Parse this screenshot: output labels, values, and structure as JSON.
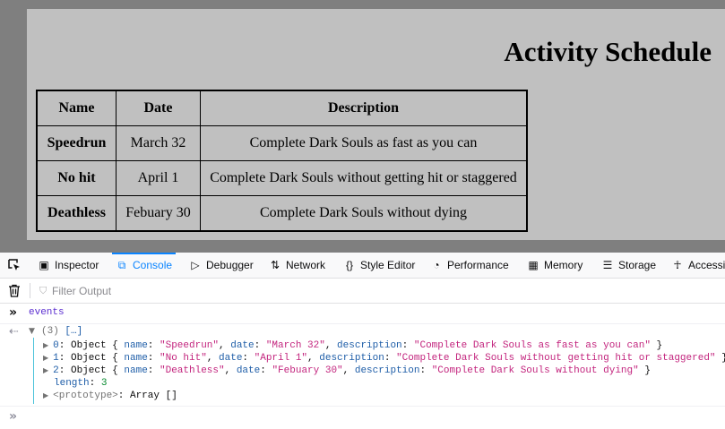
{
  "page": {
    "title": "Activity Schedule",
    "table": {
      "headers": [
        "Name",
        "Date",
        "Description"
      ],
      "rows": [
        {
          "name": "Speedrun",
          "date": "March 32",
          "description": "Complete Dark Souls as fast as you can"
        },
        {
          "name": "No hit",
          "date": "April 1",
          "description": "Complete Dark Souls without getting hit or staggered"
        },
        {
          "name": "Deathless",
          "date": "Febuary 30",
          "description": "Complete Dark Souls without dying"
        }
      ]
    }
  },
  "devtools": {
    "tabs": [
      {
        "label": "Inspector",
        "icon": "inspector-icon"
      },
      {
        "label": "Console",
        "icon": "console-icon",
        "active": true
      },
      {
        "label": "Debugger",
        "icon": "debugger-icon"
      },
      {
        "label": "Network",
        "icon": "network-icon"
      },
      {
        "label": "Style Editor",
        "icon": "style-editor-icon"
      },
      {
        "label": "Performance",
        "icon": "performance-icon"
      },
      {
        "label": "Memory",
        "icon": "memory-icon"
      },
      {
        "label": "Storage",
        "icon": "storage-icon"
      },
      {
        "label": "Accessi",
        "icon": "accessibility-icon"
      }
    ],
    "filter": {
      "placeholder": "Filter Output"
    },
    "console": {
      "command": "events",
      "result": {
        "count": "(3)",
        "preview": "[…]",
        "items": [
          {
            "index": "0",
            "type": "Object",
            "name": "\"Speedrun\"",
            "date": "\"March 32\"",
            "description": "\"Complete Dark Souls as fast as you can\""
          },
          {
            "index": "1",
            "type": "Object",
            "name": "\"No hit\"",
            "date": "\"April 1\"",
            "description": "\"Complete Dark Souls without getting hit or staggered\""
          },
          {
            "index": "2",
            "type": "Object",
            "name": "\"Deathless\"",
            "date": "\"Febuary 30\"",
            "description": "\"Complete Dark Souls without dying\""
          }
        ],
        "length_key": "length",
        "length_value": "3",
        "prototype_key": "<prototype>",
        "prototype_value": "Array []"
      }
    }
  },
  "colors": {
    "page_bg": "#c0c0c0",
    "viewport_bg": "#7f7f7f",
    "active_tab": "#0a84ff",
    "string": "#c3257e",
    "key": "#1f5ea8"
  }
}
